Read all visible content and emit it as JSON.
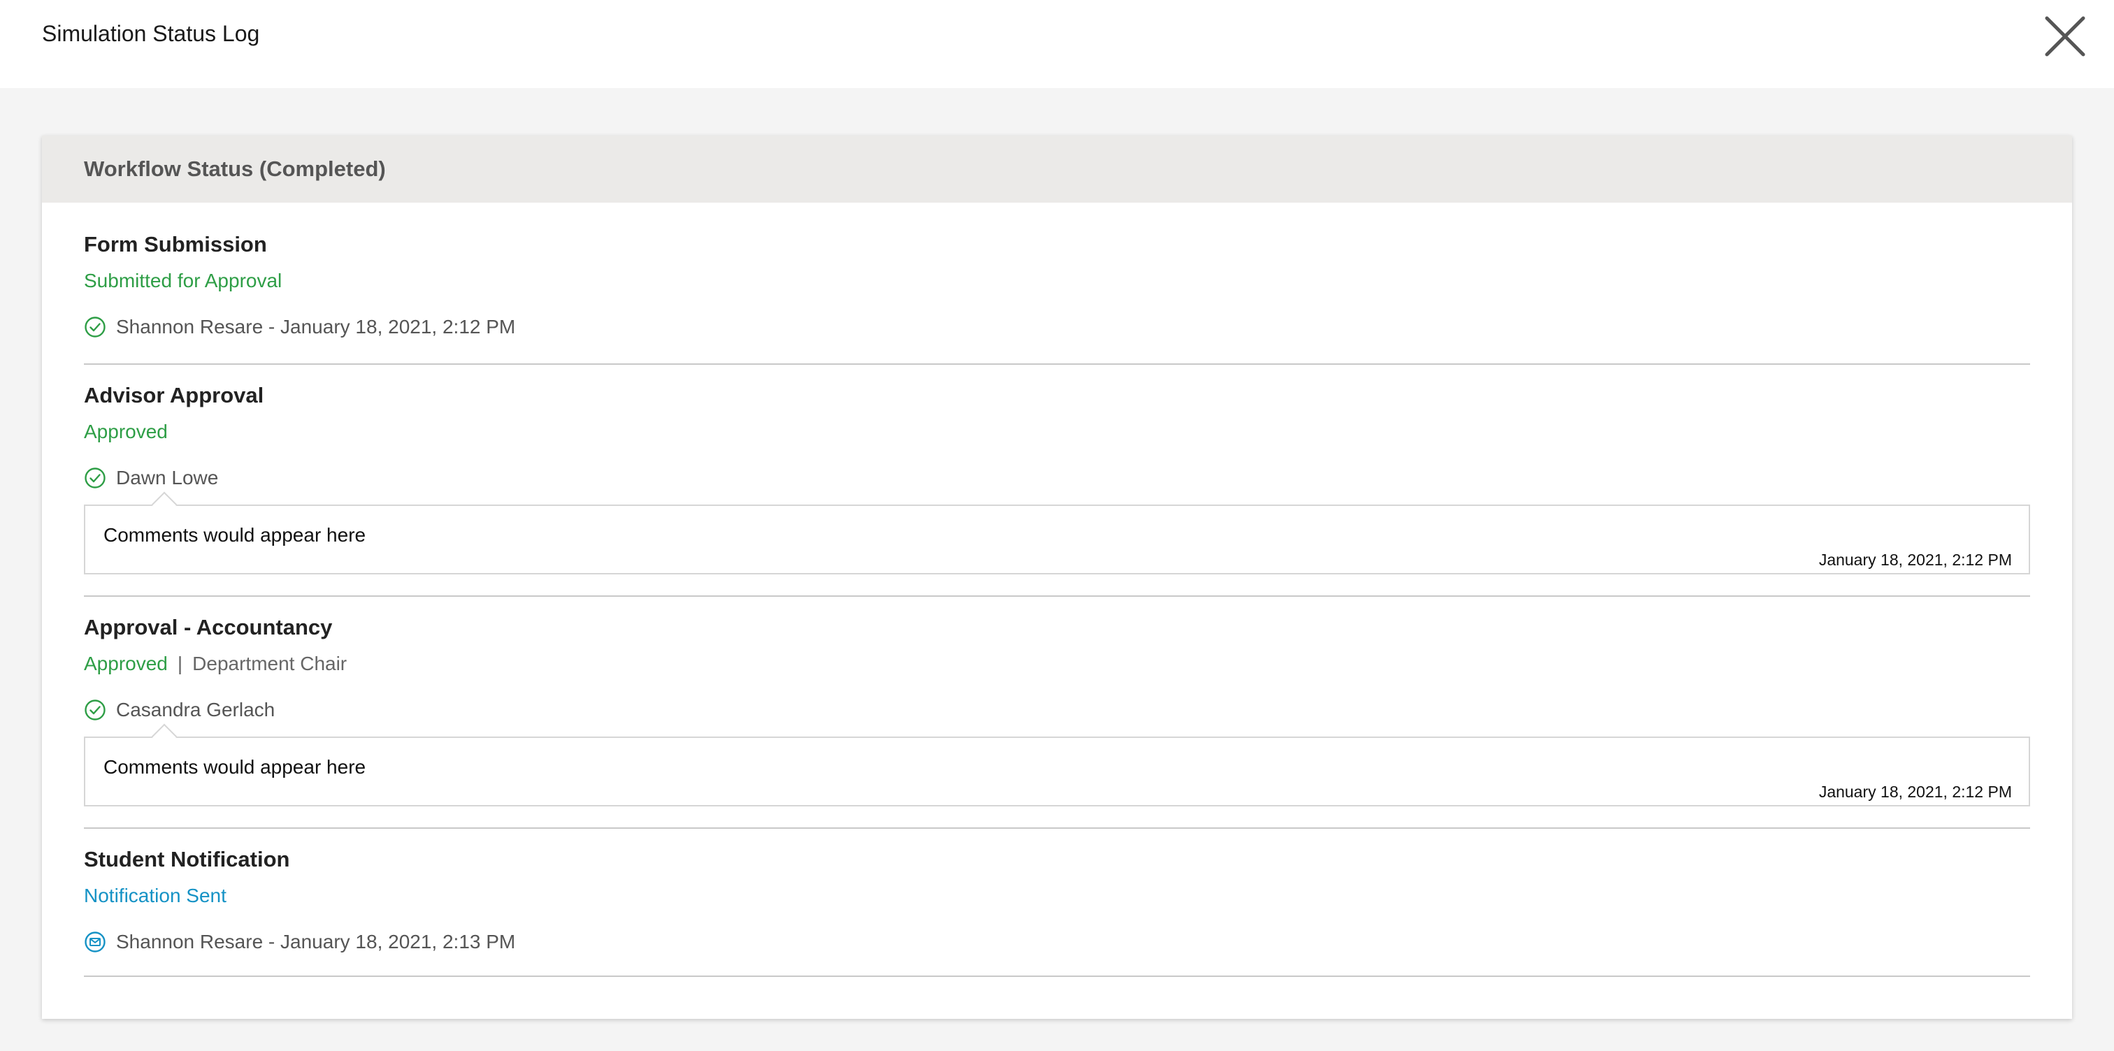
{
  "window": {
    "title": "Simulation Status Log",
    "close_icon": "close-icon"
  },
  "panel": {
    "header": "Workflow Status (Completed)",
    "colors": {
      "approved": "#2e9e46",
      "notification": "#1592c5",
      "header_bg": "#ebeae8"
    },
    "steps": [
      {
        "title": "Form Submission",
        "status": "Submitted for Approval",
        "actor": "Shannon Resare - January 18, 2021, 2:12 PM",
        "icon": "check-circle-icon"
      },
      {
        "title": "Advisor Approval",
        "status": "Approved",
        "actor": "Dawn Lowe",
        "icon": "check-circle-icon",
        "comment": {
          "text": "Comments would appear here",
          "time": "January 18, 2021, 2:12 PM"
        }
      },
      {
        "title": "Approval - Accountancy",
        "status": "Approved",
        "separator": "|",
        "role": "Department Chair",
        "actor": "Casandra Gerlach",
        "icon": "check-circle-icon",
        "comment": {
          "text": "Comments would appear here",
          "time": "January 18, 2021, 2:12 PM"
        }
      },
      {
        "title": "Student Notification",
        "status": "Notification Sent",
        "actor": "Shannon Resare - January 18, 2021, 2:13 PM",
        "icon": "mail-circle-icon"
      }
    ]
  }
}
